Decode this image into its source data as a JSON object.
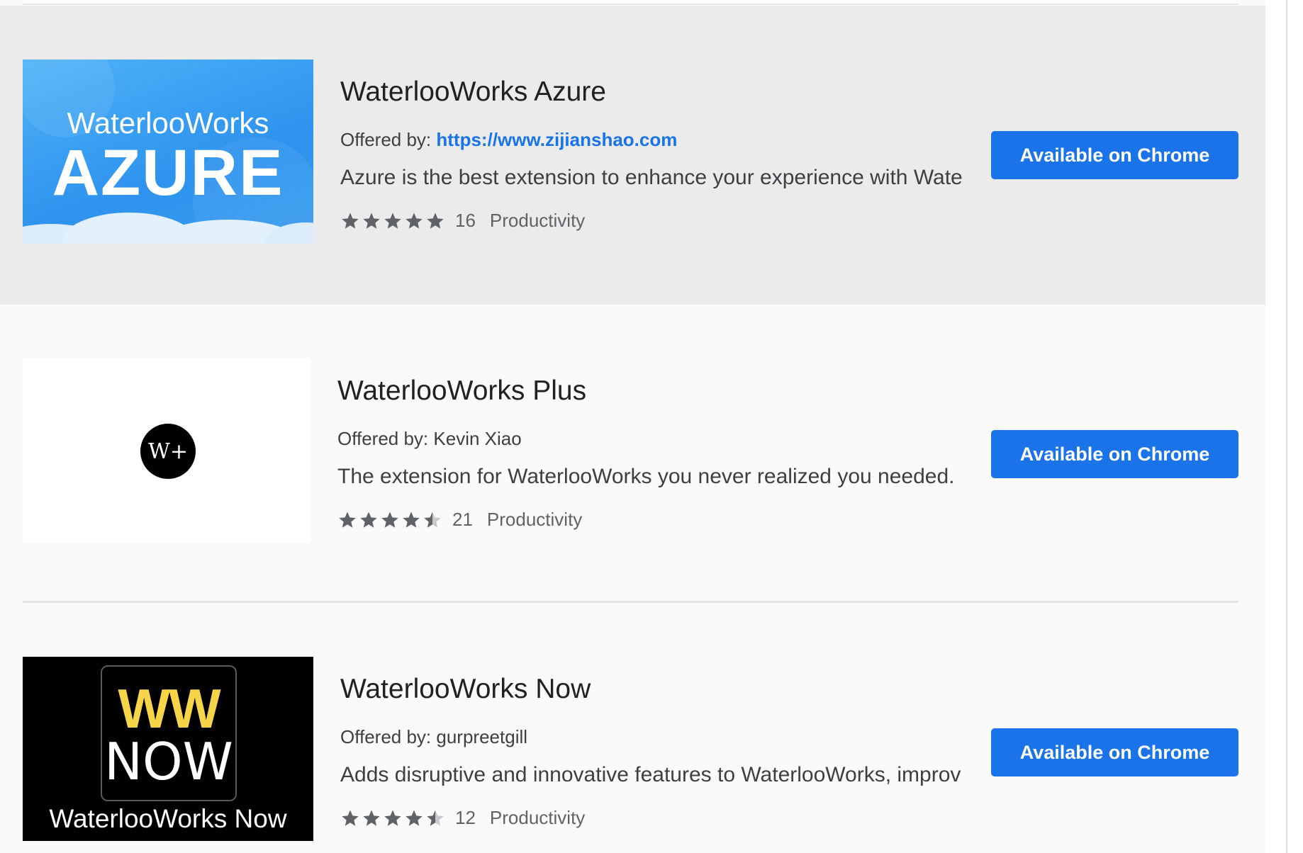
{
  "colors": {
    "accent": "#1a73e8",
    "hover_row": "#ebebeb",
    "star": "#5f6368"
  },
  "items": [
    {
      "title": "WaterlooWorks Azure",
      "offered_prefix": "Offered by:",
      "offered_by": "https://www.zijianshao.com",
      "description": "Azure is the best extension to enhance your experience with Wate",
      "rating": 5,
      "rating_count": "16",
      "category": "Productivity",
      "button": "Available on Chrome",
      "thumb_text_top": "WaterlooWorks",
      "thumb_text_big": "AZURE"
    },
    {
      "title": "WaterlooWorks Plus",
      "offered_prefix": "Offered by:",
      "offered_by": "Kevin Xiao",
      "description": "The extension for WaterlooWorks you never realized you needed.",
      "rating": 4.5,
      "rating_count": "21",
      "category": "Productivity",
      "button": "Available on Chrome",
      "thumb_logo": "W+"
    },
    {
      "title": "WaterlooWorks Now",
      "offered_prefix": "Offered by:",
      "offered_by": "gurpreetgill",
      "description": "Adds disruptive and innovative features to WaterlooWorks, improv",
      "rating": 4.5,
      "rating_count": "12",
      "category": "Productivity",
      "button": "Available on Chrome",
      "thumb_ww": "WW",
      "thumb_now": "NOW",
      "thumb_caption": "WaterlooWorks Now"
    }
  ]
}
